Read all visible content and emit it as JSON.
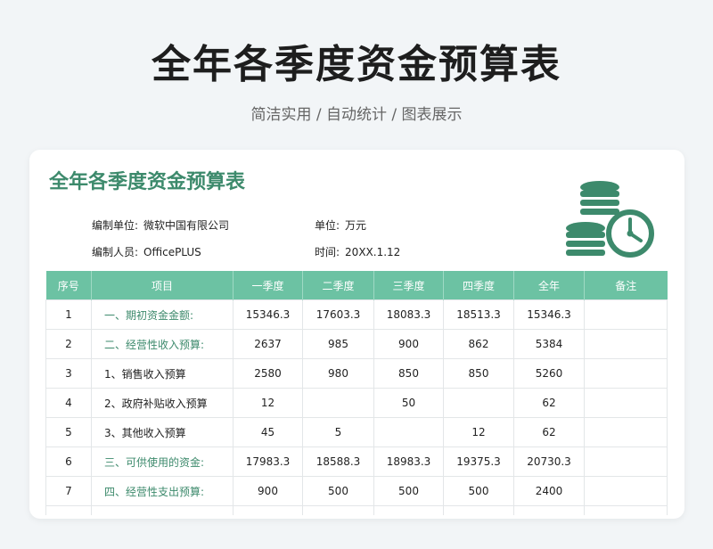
{
  "hero": {
    "title": "全年各季度资金预算表",
    "subtitle": "简洁实用 / 自动统计 / 图表展示"
  },
  "sheet": {
    "title": "全年各季度资金预算表",
    "meta": {
      "unit_org_label": "编制单位:",
      "unit_org_value": "微软中国有限公司",
      "currency_label": "单位:",
      "currency_value": "万元",
      "author_label": "编制人员:",
      "author_value": "OfficePLUS",
      "time_label": "时间:",
      "time_value": "20XX.1.12"
    },
    "icon": "coins-clock-icon",
    "accent_color": "#3d8a6c",
    "header_color": "#6cc2a3",
    "columns": [
      "序号",
      "项目",
      "一季度",
      "二季度",
      "三季度",
      "四季度",
      "全年",
      "备注"
    ],
    "rows": [
      {
        "no": "1",
        "item": "一、期初资金金额:",
        "q1": "15346.3",
        "q2": "17603.3",
        "q3": "18083.3",
        "q4": "18513.3",
        "year": "15346.3",
        "note": "",
        "highlight": true
      },
      {
        "no": "2",
        "item": "二、经营性收入预算:",
        "q1": "2637",
        "q2": "985",
        "q3": "900",
        "q4": "862",
        "year": "5384",
        "note": "",
        "highlight": true
      },
      {
        "no": "3",
        "item": "1、销售收入预算",
        "q1": "2580",
        "q2": "980",
        "q3": "850",
        "q4": "850",
        "year": "5260",
        "note": "",
        "highlight": false
      },
      {
        "no": "4",
        "item": "2、政府补贴收入预算",
        "q1": "12",
        "q2": "",
        "q3": "50",
        "q4": "",
        "year": "62",
        "note": "",
        "highlight": false
      },
      {
        "no": "5",
        "item": "3、其他收入预算",
        "q1": "45",
        "q2": "5",
        "q3": "",
        "q4": "12",
        "year": "62",
        "note": "",
        "highlight": false
      },
      {
        "no": "6",
        "item": "三、可供使用的资金:",
        "q1": "17983.3",
        "q2": "18588.3",
        "q3": "18983.3",
        "q4": "19375.3",
        "year": "20730.3",
        "note": "",
        "highlight": true
      },
      {
        "no": "7",
        "item": "四、经营性支出预算:",
        "q1": "900",
        "q2": "500",
        "q3": "500",
        "q4": "500",
        "year": "2400",
        "note": "",
        "highlight": true
      }
    ]
  }
}
